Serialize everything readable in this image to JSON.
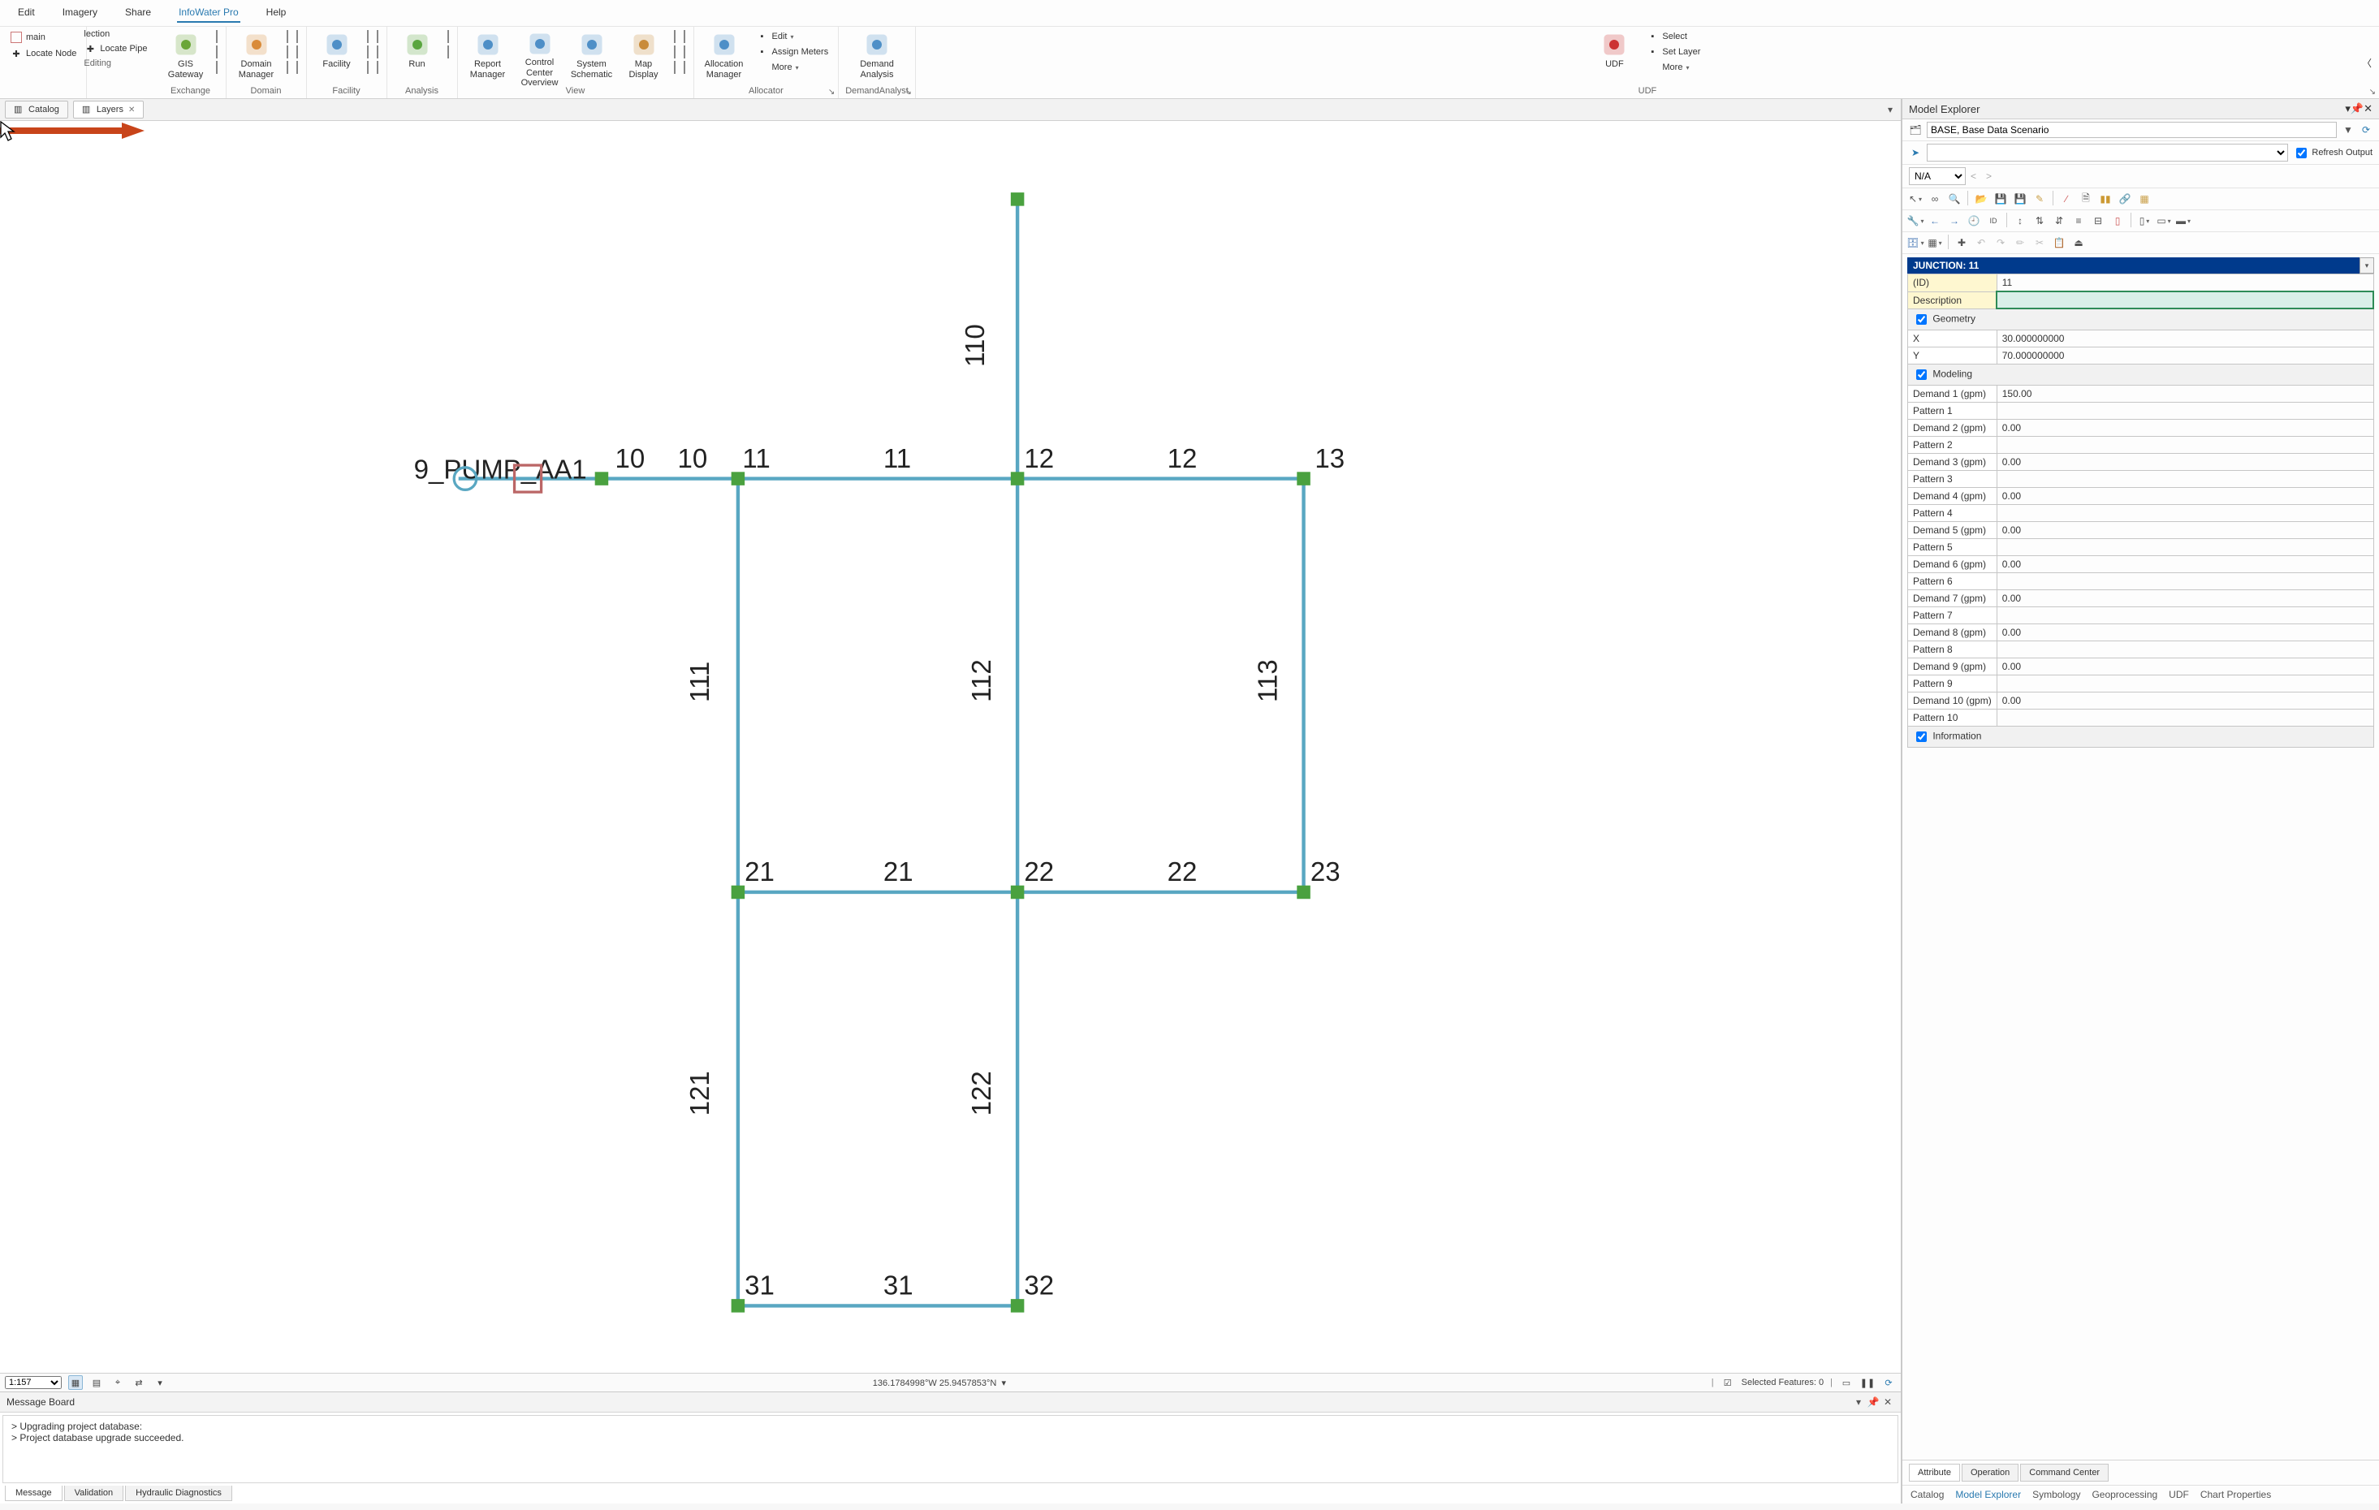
{
  "menu": {
    "items": [
      "Edit",
      "Imagery",
      "Share",
      "InfoWater Pro",
      "Help"
    ],
    "active": 3
  },
  "ribbon": {
    "left_stack": {
      "row1": [
        "main",
        "Locate Node"
      ],
      "row2": [
        "lection",
        "Locate Pipe"
      ],
      "row3": "Editing"
    },
    "groups": [
      {
        "label": "Exchange",
        "big": [
          {
            "name": "GIS Gateway",
            "icon": "gis"
          }
        ],
        "side": [
          "sq",
          "sq",
          "sq"
        ]
      },
      {
        "label": "Domain",
        "big": [
          {
            "name": "Domain Manager",
            "icon": "domain"
          }
        ],
        "side": [
          "sq",
          "sq",
          "sq",
          "sq",
          "sq",
          "sq"
        ]
      },
      {
        "label": "Facility",
        "big": [
          {
            "name": "Facility",
            "icon": "facility"
          }
        ],
        "side": [
          "sq",
          "sq",
          "sq",
          "sq",
          "sq",
          "sq"
        ]
      },
      {
        "label": "Analysis",
        "big": [
          {
            "name": "Run",
            "icon": "run"
          }
        ],
        "side": [
          "sq",
          "sq"
        ]
      },
      {
        "label": "View",
        "big": [
          {
            "name": "Report Manager",
            "icon": "report"
          },
          {
            "name": "Control Center Overview",
            "icon": "cc"
          },
          {
            "name": "System Schematic",
            "icon": "schem"
          },
          {
            "name": "Map Display",
            "icon": "mapd"
          }
        ],
        "side": [
          "sq",
          "sq",
          "sq",
          "sq",
          "sq",
          "sq"
        ]
      },
      {
        "label": "Allocator",
        "big": [
          {
            "name": "Allocation Manager",
            "icon": "alloc"
          }
        ],
        "small": [
          {
            "icon": "pencil",
            "text": "Edit",
            "dd": true
          },
          {
            "icon": "meter",
            "text": "Assign Meters"
          },
          {
            "icon": "",
            "text": "More",
            "dd": true
          }
        ],
        "launcher": true
      },
      {
        "label": "DemandAnalyst",
        "big": [
          {
            "name": "Demand Analysis",
            "icon": "demand"
          }
        ],
        "launcher": true
      },
      {
        "label": "UDF",
        "big": [
          {
            "name": "UDF",
            "icon": "udf"
          }
        ],
        "small": [
          {
            "icon": "sel",
            "text": "Select"
          },
          {
            "icon": "layer",
            "text": "Set Layer"
          },
          {
            "icon": "",
            "text": "More",
            "dd": true
          }
        ],
        "launcher": true
      }
    ]
  },
  "doctabs": [
    {
      "label": "Catalog",
      "icon": "catalog",
      "active": false,
      "closable": false
    },
    {
      "label": "Layers",
      "icon": "layers",
      "active": true,
      "closable": true
    }
  ],
  "map": {
    "pump_label": "9_PUMP_AA1",
    "top_labels": {
      "top110": "110",
      "l10a": "10",
      "l10b": "10",
      "l11": "11",
      "l11m": "11",
      "l12": "12",
      "l12m": "12",
      "l13": "13",
      "l21": "21",
      "l21m": "21",
      "l22": "22",
      "l22m": "22",
      "l23": "23",
      "l31": "31",
      "l31m": "31",
      "l32": "32",
      "v111": "111",
      "v112": "112",
      "v113": "113",
      "v121": "121",
      "v122": "122"
    }
  },
  "mapstatus": {
    "scale": "1:157",
    "coords": "136.1784998°W 25.9457853°N",
    "selected": "Selected Features: 0"
  },
  "msg": {
    "title": "Message Board",
    "lines": [
      "> Upgrading project database:",
      "> Project database upgrade succeeded."
    ],
    "tabs": [
      "Message",
      "Validation",
      "Hydraulic Diagnostics"
    ],
    "active": 0
  },
  "explorer": {
    "title": "Model Explorer",
    "scenario": "BASE, Base Data Scenario",
    "na": "N/A",
    "refresh": "Refresh Output",
    "selected": "JUNCTION: 11",
    "tabs": [
      "Attribute",
      "Operation",
      "Command Center"
    ],
    "active_tab": 0,
    "btabs": [
      "Catalog",
      "Model Explorer",
      "Symbology",
      "Geoprocessing",
      "UDF",
      "Chart Properties"
    ],
    "active_btab": 1,
    "props": [
      {
        "k": "(ID)",
        "v": "11",
        "hdr": true
      },
      {
        "k": "Description",
        "v": "",
        "hdr": true,
        "desc": true
      },
      {
        "group": "Geometry"
      },
      {
        "k": "X",
        "v": "30.000000000"
      },
      {
        "k": "Y",
        "v": "70.000000000"
      },
      {
        "group": "Modeling"
      },
      {
        "k": "Demand 1 (gpm)",
        "v": "150.00"
      },
      {
        "k": "Pattern 1",
        "v": ""
      },
      {
        "k": "Demand 2 (gpm)",
        "v": "0.00"
      },
      {
        "k": "Pattern 2",
        "v": ""
      },
      {
        "k": "Demand 3 (gpm)",
        "v": "0.00"
      },
      {
        "k": "Pattern 3",
        "v": ""
      },
      {
        "k": "Demand 4 (gpm)",
        "v": "0.00"
      },
      {
        "k": "Pattern 4",
        "v": ""
      },
      {
        "k": "Demand 5 (gpm)",
        "v": "0.00"
      },
      {
        "k": "Pattern 5",
        "v": ""
      },
      {
        "k": "Demand 6 (gpm)",
        "v": "0.00"
      },
      {
        "k": "Pattern 6",
        "v": ""
      },
      {
        "k": "Demand 7 (gpm)",
        "v": "0.00"
      },
      {
        "k": "Pattern 7",
        "v": ""
      },
      {
        "k": "Demand 8 (gpm)",
        "v": "0.00"
      },
      {
        "k": "Pattern 8",
        "v": ""
      },
      {
        "k": "Demand 9 (gpm)",
        "v": "0.00"
      },
      {
        "k": "Pattern 9",
        "v": ""
      },
      {
        "k": "Demand 10 (gpm)",
        "v": "0.00"
      },
      {
        "k": "Pattern 10",
        "v": ""
      },
      {
        "group": "Information"
      }
    ]
  }
}
